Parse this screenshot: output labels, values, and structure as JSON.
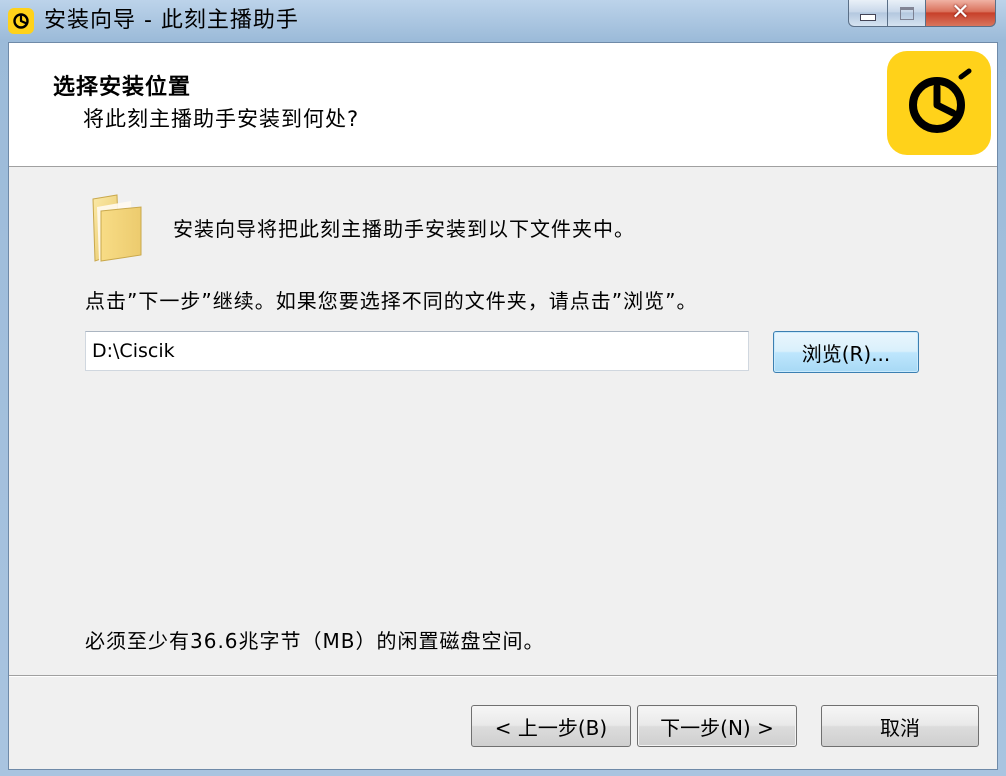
{
  "window": {
    "title": "安装向导 - 此刻主播助手",
    "brand_color": "#ffd21a"
  },
  "header": {
    "title": "选择安装位置",
    "subtitle": "将此刻主播助手安装到何处?"
  },
  "main": {
    "description": "安装向导将把此刻主播助手安装到以下文件夹中。",
    "instruction": "点击”下一步”继续。如果您要选择不同的文件夹，请点击”浏览”。",
    "install_path": "D:\\Ciscik",
    "browse_label": "浏览(R)...",
    "disk_space": "必须至少有36.6兆字节（MB）的闲置磁盘空间。"
  },
  "footer": {
    "back_label": "< 上一步(B)",
    "next_label": "下一步(N) >",
    "cancel_label": "取消"
  }
}
